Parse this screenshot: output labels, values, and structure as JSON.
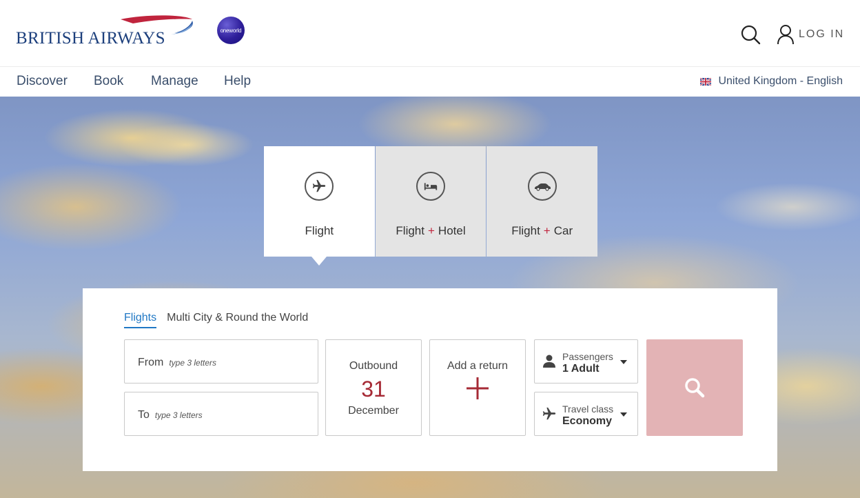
{
  "header": {
    "brand": "BRITISH AIRWAYS",
    "alliance": "oneworld",
    "login_label": "LOG IN",
    "colors": {
      "brand_blue": "#1c3f7c",
      "brand_red": "#c0243d"
    }
  },
  "nav": {
    "items": [
      "Discover",
      "Book",
      "Manage",
      "Help"
    ],
    "locale": "United Kingdom - English"
  },
  "booking_tabs": [
    {
      "label": "Flight",
      "icon": "plane-icon",
      "active": true
    },
    {
      "label_main": "Flight",
      "label_plus": "+",
      "label_extra": "Hotel",
      "icon": "bed-icon",
      "active": false
    },
    {
      "label_main": "Flight",
      "label_plus": "+",
      "label_extra": "Car",
      "icon": "car-icon",
      "active": false
    }
  ],
  "search_form": {
    "subtabs": [
      "Flights",
      "Multi City & Round the World"
    ],
    "from": {
      "label": "From",
      "placeholder": "type 3 letters"
    },
    "to": {
      "label": "To",
      "placeholder": "type 3 letters"
    },
    "outbound": {
      "label": "Outbound",
      "day": "31",
      "month": "December"
    },
    "return": {
      "label": "Add a return"
    },
    "passengers": {
      "label": "Passengers",
      "value": "1 Adult"
    },
    "travel_class": {
      "label": "Travel class",
      "value": "Economy"
    },
    "search_button_color": "#e3b3b5"
  }
}
